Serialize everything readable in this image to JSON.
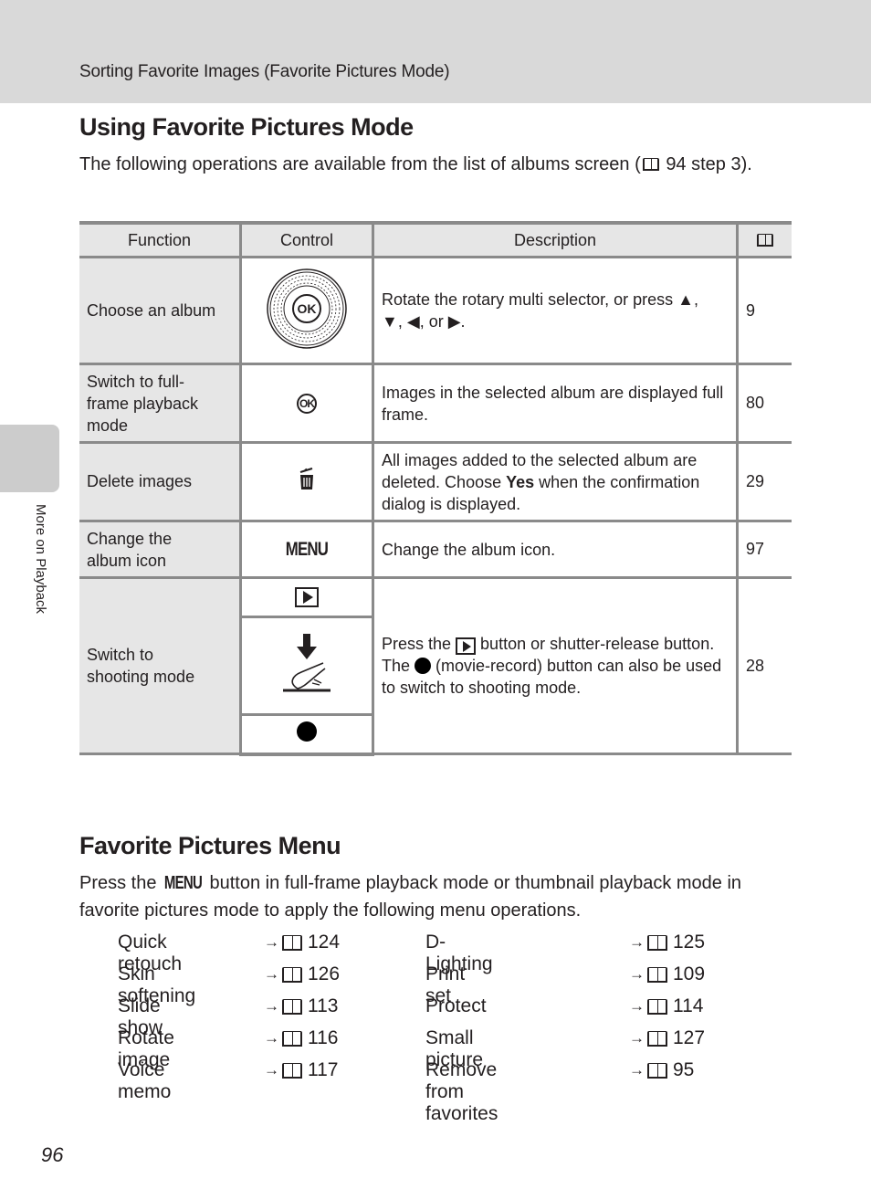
{
  "header": {
    "title": "Sorting Favorite Images (Favorite Pictures Mode)"
  },
  "side_tab": {
    "label": "More on Playback"
  },
  "section1": {
    "title": "Using Favorite Pictures Mode",
    "intro_before": "The following operations are available from the list of albums screen (",
    "intro_ref": "94 step 3)."
  },
  "table": {
    "headers": {
      "function": "Function",
      "control": "Control",
      "description": "Description",
      "page_icon": "book-icon"
    },
    "rows": [
      {
        "function": "Choose an album",
        "control_icon": "rotary-multi-selector-icon",
        "control_text": "OK",
        "description_parts": [
          "Rotate the rotary multi selector, or press ",
          "▲",
          ", ",
          "▼",
          ", ",
          "◀",
          ", or ",
          "▶",
          "."
        ],
        "page": "9"
      },
      {
        "function": "Switch to full-frame playback mode",
        "control_icon": "ok-button-icon",
        "control_text": "OK",
        "description": "Images in the selected album are displayed full frame.",
        "page": "80"
      },
      {
        "function": "Delete images",
        "control_icon": "trash-icon",
        "description_before": "All images added to the selected album are deleted. Choose ",
        "description_bold": "Yes",
        "description_after": " when the confirmation dialog is displayed.",
        "page": "29"
      },
      {
        "function": "Change the album icon",
        "control_icon": "menu-button-icon",
        "control_text": "MENU",
        "description": "Change the album icon.",
        "page": "97"
      },
      {
        "function": "Switch to shooting mode",
        "control_icons": [
          "playback-button-icon",
          "shutter-release-icon",
          "movie-record-icon"
        ],
        "description_a": "Press the ",
        "description_b": " button or shutter-release button. The ",
        "description_c": " (movie-record) button can also be used to switch to shooting mode.",
        "page": "28"
      }
    ]
  },
  "section2": {
    "title": "Favorite Pictures Menu",
    "text_before": "Press the ",
    "menu_label": "MENU",
    "text_after": " button in full-frame playback mode or thumbnail playback mode in favorite pictures mode to apply the following menu operations."
  },
  "operations": {
    "arrow": "→",
    "left": [
      {
        "name": "Quick retouch",
        "page": "124"
      },
      {
        "name": "Skin softening",
        "page": "126"
      },
      {
        "name": "Slide show",
        "page": "113"
      },
      {
        "name": "Rotate image",
        "page": "116"
      },
      {
        "name": "Voice memo",
        "page": "117"
      }
    ],
    "right": [
      {
        "name": "D-Lighting",
        "page": "125"
      },
      {
        "name": "Print set",
        "page": "109"
      },
      {
        "name": "Protect",
        "page": "114"
      },
      {
        "name": "Small picture",
        "page": "127"
      },
      {
        "name": "Remove from favorites",
        "page": "95"
      }
    ]
  },
  "page_number": "96"
}
